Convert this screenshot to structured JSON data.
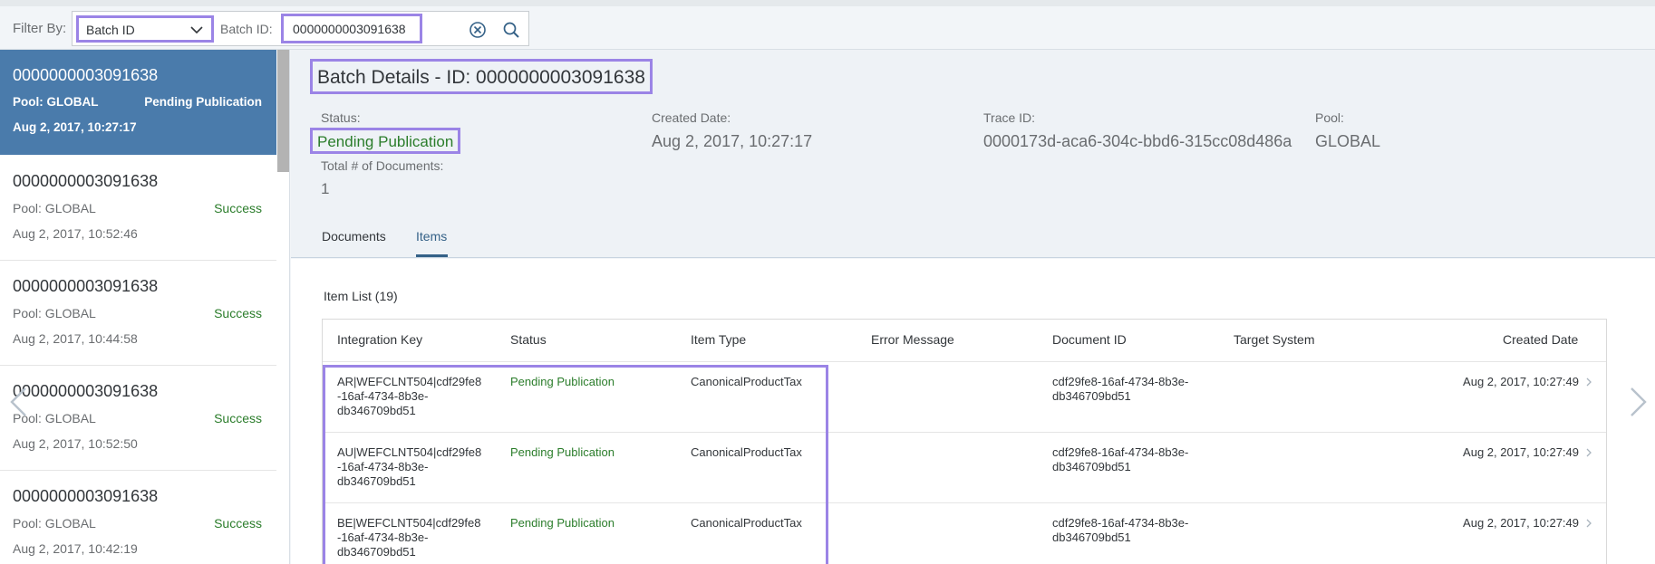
{
  "filter": {
    "label": "Filter By:",
    "select_value": "Batch ID",
    "batch_id_label": "Batch ID:",
    "batch_id_value": "0000000003091638"
  },
  "batches": [
    {
      "id": "0000000003091638",
      "pool": "Pool: GLOBAL",
      "status": "Pending Publication",
      "date": "Aug 2, 2017, 10:27:17",
      "selected": true
    },
    {
      "id": "0000000003091638",
      "pool": "Pool: GLOBAL",
      "status": "Success",
      "date": "Aug 2, 2017, 10:52:46"
    },
    {
      "id": "0000000003091638",
      "pool": "Pool: GLOBAL",
      "status": "Success",
      "date": "Aug 2, 2017, 10:44:58"
    },
    {
      "id": "0000000003091638",
      "pool": "Pool: GLOBAL",
      "status": "Success",
      "date": "Aug 2, 2017, 10:52:50"
    },
    {
      "id": "0000000003091638",
      "pool": "Pool: GLOBAL",
      "status": "Success",
      "date": "Aug 2, 2017, 10:42:19"
    }
  ],
  "detail": {
    "title": "Batch Details - ID: 0000000003091638",
    "status_label": "Status:",
    "status_value": "Pending Publication",
    "created_label": "Created Date:",
    "created_value": "Aug 2, 2017, 10:27:17",
    "trace_label": "Trace ID:",
    "trace_value": "0000173d-aca6-304c-bbd6-315cc08d486a",
    "pool_label": "Pool:",
    "pool_value": "GLOBAL",
    "docs_label": "Total # of Documents:",
    "docs_value": "1",
    "tabs": [
      "Documents",
      "Items"
    ]
  },
  "items": {
    "title": "Item List  (19)",
    "columns": [
      "Integration Key",
      "Status",
      "Item Type",
      "Error Message",
      "Document ID",
      "Target System",
      "Created Date"
    ],
    "rows": [
      {
        "key": [
          "AR|WEFCLNT504|cdf29fe8",
          "-16af-4734-8b3e-",
          "db346709bd51"
        ],
        "status": "Pending Publication",
        "type": "CanonicalProductTax",
        "error": "",
        "doc": [
          "cdf29fe8-16af-4734-8b3e-",
          "db346709bd51"
        ],
        "target": "",
        "created": "Aug 2, 2017, 10:27:49"
      },
      {
        "key": [
          "AU|WEFCLNT504|cdf29fe8",
          "-16af-4734-8b3e-",
          "db346709bd51"
        ],
        "status": "Pending Publication",
        "type": "CanonicalProductTax",
        "error": "",
        "doc": [
          "cdf29fe8-16af-4734-8b3e-",
          "db346709bd51"
        ],
        "target": "",
        "created": "Aug 2, 2017, 10:27:49"
      },
      {
        "key": [
          "BE|WEFCLNT504|cdf29fe8",
          "-16af-4734-8b3e-",
          "db346709bd51"
        ],
        "status": "Pending Publication",
        "type": "CanonicalProductTax",
        "error": "",
        "doc": [
          "cdf29fe8-16af-4734-8b3e-",
          "db346709bd51"
        ],
        "target": "",
        "created": "Aug 2, 2017, 10:27:49"
      }
    ]
  },
  "icons": {
    "chevron": "chevron-down-icon",
    "clear": "clear-icon",
    "search": "search-icon",
    "row_nav": "chevron-right-icon",
    "prev": "arrow-left-icon",
    "next": "arrow-right-icon"
  },
  "colors": {
    "selected_bg": "#4a7bab",
    "success": "#2b7d2b",
    "highlight": "#9b84e6",
    "accent": "#346187"
  }
}
